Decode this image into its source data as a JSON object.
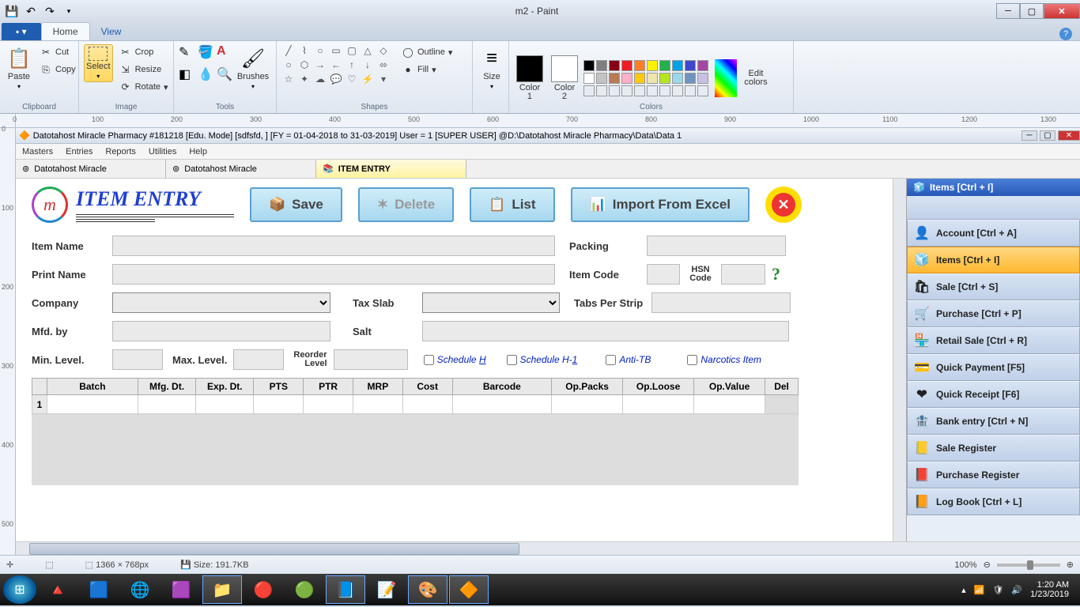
{
  "paint": {
    "title": "m2 - Paint",
    "tabs": {
      "home": "Home",
      "view": "View"
    },
    "clipboard": {
      "label": "Clipboard",
      "paste": "Paste",
      "cut": "Cut",
      "copy": "Copy"
    },
    "image": {
      "label": "Image",
      "select": "Select",
      "crop": "Crop",
      "resize": "Resize",
      "rotate": "Rotate"
    },
    "tools": {
      "label": "Tools",
      "brushes": "Brushes"
    },
    "shapes": {
      "label": "Shapes",
      "outline": "Outline",
      "fill": "Fill"
    },
    "size": {
      "label": "Size"
    },
    "colors": {
      "label": "Colors",
      "color1": "Color\n1",
      "color2": "Color\n2",
      "edit": "Edit\ncolors"
    },
    "status": {
      "dims": "1366 × 768px",
      "size": "Size: 191.7KB",
      "zoom": "100%"
    }
  },
  "inner": {
    "title": "Datotahost Miracle Pharmacy #181218  [Edu. Mode]  [sdfsfd, ] [FY = 01-04-2018 to 31-03-2019] User = 1 [SUPER USER]  @D:\\Datotahost Miracle Pharmacy\\Data\\Data 1",
    "menu": [
      "Masters",
      "Entries",
      "Reports",
      "Utilities",
      "Help"
    ],
    "tabs": [
      "Datotahost Miracle",
      "Datotahost Miracle",
      "ITEM ENTRY"
    ],
    "page_title": "ITEM ENTRY",
    "buttons": {
      "save": "Save",
      "delete": "Delete",
      "list": "List",
      "import": "Import From Excel"
    },
    "labels": {
      "item_name": "Item Name",
      "packing": "Packing",
      "print_name": "Print Name",
      "item_code": "Item Code",
      "hsn_code": "HSN\nCode",
      "company": "Company",
      "tax_slab": "Tax Slab",
      "tabs_strip": "Tabs Per Strip",
      "mfd_by": "Mfd. by",
      "salt": "Salt",
      "min_level": "Min. Level.",
      "max_level": "Max. Level.",
      "reorder": "Reorder\nLevel",
      "schedule_h": "Schedule ",
      "schedule_h_u": "H",
      "schedule_h1": "Schedule H-",
      "schedule_h1_u": "1",
      "anti_tb": "Anti-TB",
      "narcotics": "Narcotics Item"
    },
    "grid_cols": [
      "Batch",
      "Mfg. Dt.",
      "Exp. Dt.",
      "PTS",
      "PTR",
      "MRP",
      "Cost",
      "Barcode",
      "Op.Packs",
      "Op.Loose",
      "Op.Value",
      "Del"
    ],
    "grid_row1": "1",
    "side": {
      "header": "Items [Ctrl + I]",
      "items": [
        "Account [Ctrl + A]",
        "Items [Ctrl + I]",
        "Sale [Ctrl + S]",
        "Purchase [Ctrl + P]",
        "Retail Sale [Ctrl + R]",
        "Quick Payment [F5]",
        "Quick Receipt [F6]",
        "Bank entry [Ctrl + N]",
        "Sale Register",
        "Purchase Register",
        "Log Book [Ctrl + L]"
      ]
    }
  },
  "taskbar": {
    "time": "1:20 AM",
    "date": "1/23/2019"
  },
  "ruler_h": [
    "0",
    "100",
    "200",
    "300",
    "400",
    "500",
    "600",
    "700",
    "800",
    "900",
    "1000",
    "1100",
    "1200",
    "1300"
  ],
  "ruler_v": [
    "0",
    "100",
    "200",
    "300",
    "400",
    "500"
  ]
}
